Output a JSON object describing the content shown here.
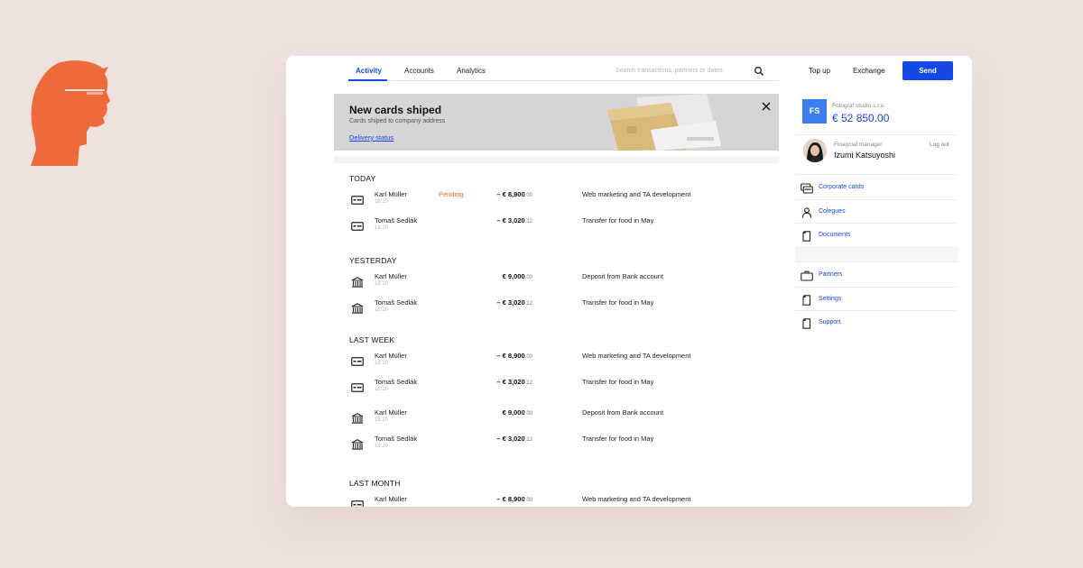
{
  "nav": {
    "tabs": [
      {
        "label": "Activity"
      },
      {
        "label": "Accounts"
      },
      {
        "label": "Analytics"
      }
    ],
    "search_placeholder": "Search transactions, partners or dates"
  },
  "actions": {
    "top_up": "Top up",
    "exchange": "Exchange",
    "send": "Send"
  },
  "banner": {
    "title": "New cards shiped",
    "subtitle": "Cards shiped to company address",
    "link": "Delivery status"
  },
  "groups": [
    {
      "title": "TODAY",
      "rows": [
        {
          "icon": "card-icon",
          "name": "Karl Müller",
          "time": "18:20",
          "status": "Pending",
          "amount": "– € 8,900",
          "cents": ".00",
          "desc": "Web marketing and TA development"
        },
        {
          "icon": "card-icon",
          "name": "Tomaš Sedlák",
          "time": "18:20",
          "status": "",
          "amount": "– € 3,020",
          "cents": ".12",
          "desc": "Transfer for food in May"
        }
      ]
    },
    {
      "title": "YESTERDAY",
      "rows": [
        {
          "icon": "bank-icon",
          "name": "Karl Müller",
          "time": "18:20",
          "status": "",
          "amount": "€ 9,000",
          "cents": ".00",
          "desc": "Deposit from Bank account"
        },
        {
          "icon": "bank-icon",
          "name": "Tomaš Sedlák",
          "time": "18:20",
          "status": "",
          "amount": "– € 3,020",
          "cents": ".12",
          "desc": "Transfer for food in May"
        }
      ]
    },
    {
      "title": "LAST WEEK",
      "rows": [
        {
          "icon": "card-icon",
          "name": "Karl Müller",
          "time": "18:20",
          "status": "",
          "amount": "– € 8,900",
          "cents": ".00",
          "desc": "Web marketing and TA development"
        },
        {
          "icon": "card-icon",
          "name": "Tomaš Sedlák",
          "time": "18:20",
          "status": "",
          "amount": "– € 3,020",
          "cents": ".12",
          "desc": "Transfer for food in May"
        },
        {
          "icon": "bank-icon",
          "name": "Karl Müller",
          "time": "18:20",
          "status": "",
          "amount": "€ 9,000",
          "cents": ".00",
          "desc": "Deposit from Bank account"
        },
        {
          "icon": "bank-icon",
          "name": "Tomaš Sedlák",
          "time": "18:20",
          "status": "",
          "amount": "– € 3,020",
          "cents": ".12",
          "desc": "Transfer for food in May"
        }
      ]
    },
    {
      "title": "LAST MONTH",
      "rows": [
        {
          "icon": "card-icon",
          "name": "Karl Müller",
          "time": "",
          "status": "",
          "amount": "– € 8,900",
          "cents": ".00",
          "desc": "Web marketing and TA development"
        }
      ]
    }
  ],
  "account": {
    "initials": "FS",
    "company": "Fotograf studio s.r.o",
    "balance": "€ 52 850.00"
  },
  "user": {
    "role": "Financial manager",
    "name": "Izumi Katsuyoshi",
    "logout": "Log out"
  },
  "menu_primary": [
    {
      "icon": "cards-icon",
      "label": "Corporate cards"
    },
    {
      "icon": "person-icon",
      "label": "Colegues"
    },
    {
      "icon": "document-icon",
      "label": "Documents"
    }
  ],
  "menu_secondary": [
    {
      "icon": "briefcase-icon",
      "label": "Partners"
    },
    {
      "icon": "document-icon",
      "label": "Settings"
    },
    {
      "icon": "document-icon",
      "label": "Support"
    }
  ],
  "colors": {
    "accent": "#1549e6",
    "pending": "#e36a1e",
    "brand_logo": "#ee6a3a",
    "background": "#efe2de"
  }
}
